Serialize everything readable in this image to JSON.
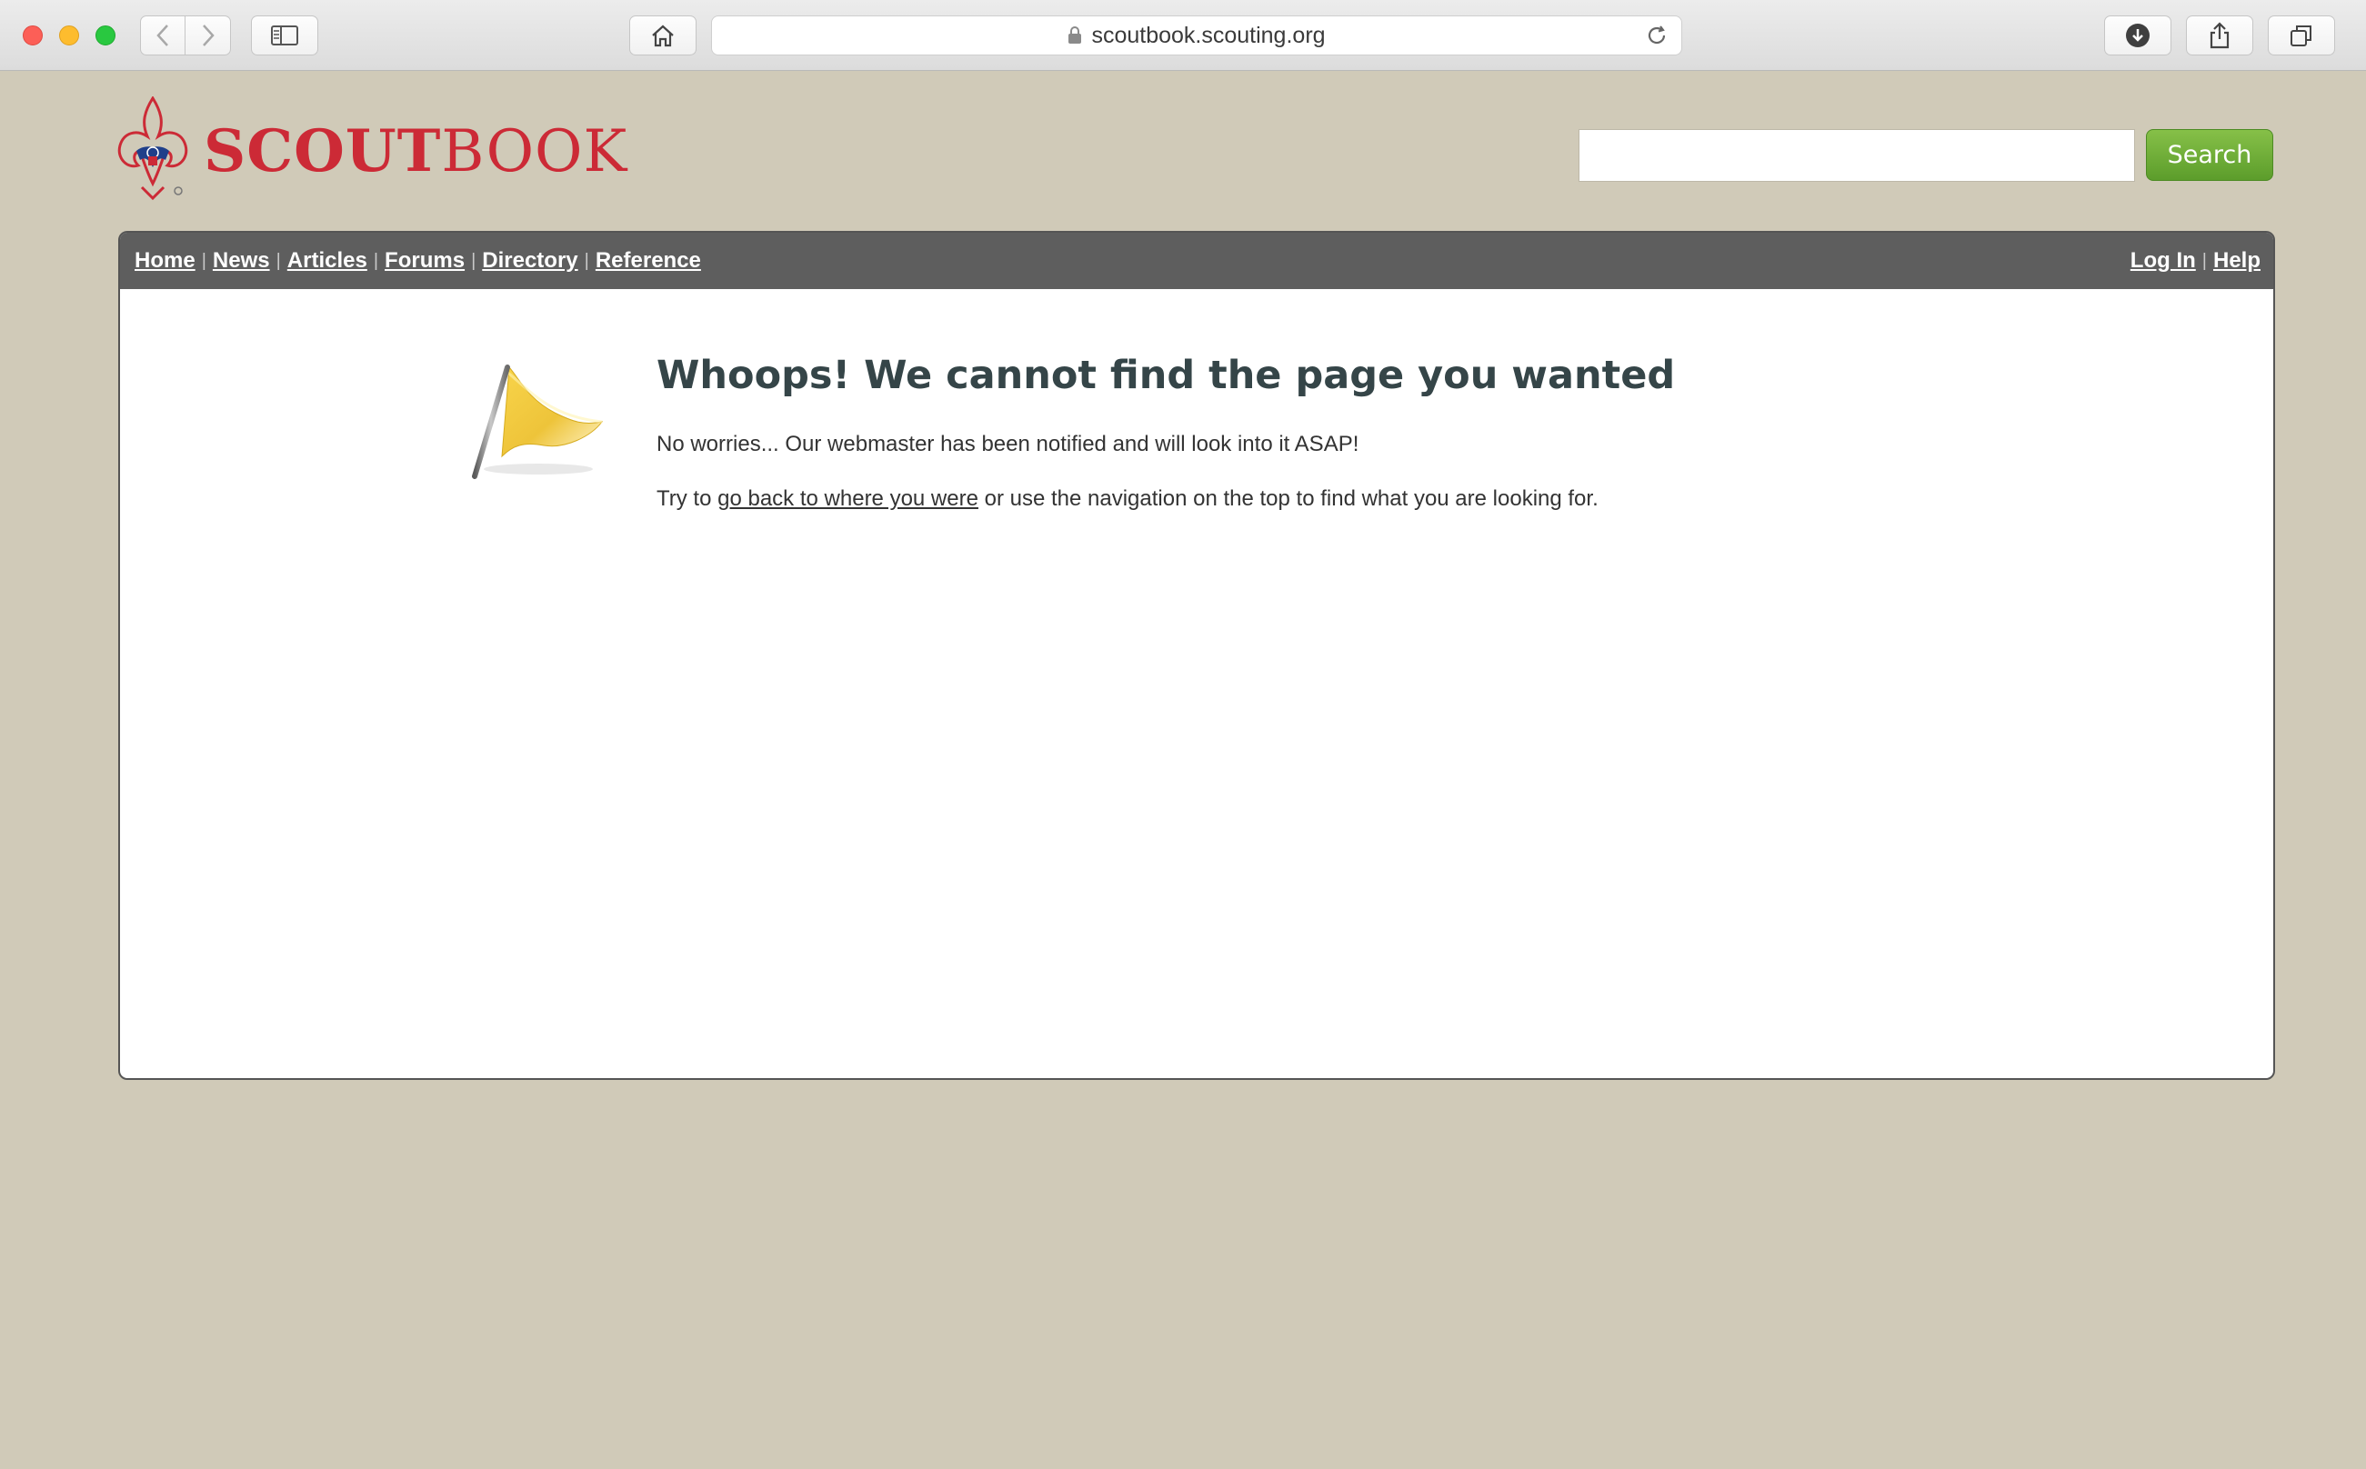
{
  "browser": {
    "url": "scoutbook.scouting.org"
  },
  "header": {
    "logo_part1": "SCOUT",
    "logo_part2": "BOOK",
    "search_value": "",
    "search_button": "Search"
  },
  "nav": {
    "left": [
      {
        "label": "Home"
      },
      {
        "label": "News"
      },
      {
        "label": "Articles"
      },
      {
        "label": "Forums"
      },
      {
        "label": "Directory"
      },
      {
        "label": "Reference"
      }
    ],
    "separator": "|",
    "right": [
      {
        "label": "Log In"
      },
      {
        "label": "Help"
      }
    ]
  },
  "error": {
    "title": "Whoops! We cannot find the page you wanted",
    "message": "No worries... Our webmaster has been notified and will look into it ASAP!",
    "hint_before": "Try to ",
    "hint_link": "go back to where you were",
    "hint_after": " or use the navigation on the top to find what you are looking for."
  },
  "colors": {
    "page_bg": "#d0cab8",
    "brand_red": "#cc2a36",
    "nav_bg": "#5e5e5e",
    "search_green": "#6aab34",
    "title_color": "#354548"
  },
  "icons": [
    "back-icon",
    "forward-icon",
    "sidebar-icon",
    "home-icon",
    "lock-icon",
    "reload-icon",
    "download-icon",
    "share-icon",
    "tabs-icon",
    "fleur-de-lis-logo",
    "flag-icon"
  ]
}
